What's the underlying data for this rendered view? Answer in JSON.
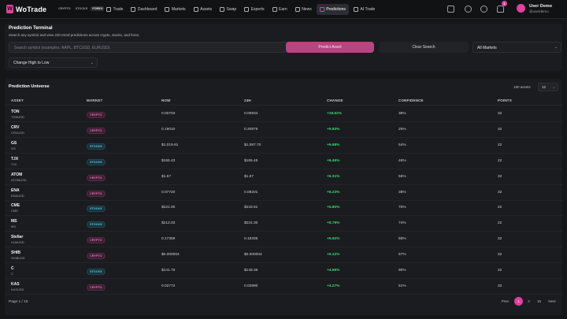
{
  "brand": {
    "name": "WoTrade",
    "mark": "W"
  },
  "market_switch": [
    {
      "label": "CRYPTO",
      "active": false
    },
    {
      "label": "STOCKS",
      "active": false
    },
    {
      "label": "FOREX",
      "active": true
    }
  ],
  "nav": [
    {
      "label": "Trade",
      "icon": "trade-icon",
      "active": false
    },
    {
      "label": "Dashboard",
      "icon": "dashboard-icon",
      "active": false
    },
    {
      "label": "Markets",
      "icon": "markets-icon",
      "active": false
    },
    {
      "label": "Assets",
      "icon": "assets-icon",
      "active": false
    },
    {
      "label": "Swap",
      "icon": "swap-icon",
      "active": false
    },
    {
      "label": "Experts",
      "icon": "experts-icon",
      "active": false
    },
    {
      "label": "Earn",
      "icon": "earn-icon",
      "active": false
    },
    {
      "label": "News",
      "icon": "news-icon",
      "active": false
    },
    {
      "label": "Predictions",
      "icon": "predictions-icon",
      "active": true
    },
    {
      "label": "AI Trade",
      "icon": "robot-icon",
      "active": false
    }
  ],
  "topbar": {
    "notification_count": "1",
    "user_name": "User Demo",
    "user_handle": "@userdemo"
  },
  "terminal": {
    "title": "Prediction Terminal",
    "subtitle": "Search any symbol and view 24h trend predictions across crypto, stocks, and forex.",
    "search_placeholder": "Search symbol (examples: AAPL, BTCUSD, EURUSD)",
    "predict_label": "Predict Asset",
    "clear_label": "Clear Search",
    "market_select": "All Markets",
    "sort_select": "Change High to Low"
  },
  "universe": {
    "title": "Prediction Universe",
    "count": "180",
    "count_label": "assets",
    "per_page": "12",
    "columns": [
      "ASSET",
      "MARKET",
      "NOW",
      "24H",
      "CHANGE",
      "CONFIDENCE",
      "POINTS"
    ],
    "rows": [
      {
        "symbol": "TON",
        "pair": "TONUSD",
        "market": "CRYPTO",
        "now": "0.00703",
        "h24": "0.00834",
        "change": "+18.62%",
        "confidence": "38%",
        "points": "32"
      },
      {
        "symbol": "CRV",
        "pair": "CRVUSD",
        "market": "CRYPTO",
        "now": "0.19010",
        "h24": "0.20879",
        "change": "+9.83%",
        "confidence": "25%",
        "points": "32"
      },
      {
        "symbol": "GS",
        "pair": "GS",
        "market": "STOCKS",
        "now": "$1,019.61",
        "h24": "$1,087.70",
        "change": "+6.68%",
        "confidence": "54%",
        "points": "22"
      },
      {
        "symbol": "TJX",
        "pair": "TJX",
        "market": "STOCKS",
        "now": "$155.43",
        "h24": "$165.45",
        "change": "+6.46%",
        "confidence": "46%",
        "points": "22"
      },
      {
        "symbol": "ATOM",
        "pair": "ATOMUSD",
        "market": "CRYPTO",
        "now": "$1.57",
        "h24": "$1.67",
        "change": "+6.31%",
        "confidence": "56%",
        "points": "32"
      },
      {
        "symbol": "ENA",
        "pair": "ENAUSD",
        "market": "CRYPTO",
        "now": "0.07720",
        "h24": "0.08201",
        "change": "+6.23%",
        "confidence": "38%",
        "points": "32"
      },
      {
        "symbol": "CME",
        "pair": "CME",
        "market": "STOCKS",
        "now": "$221.00",
        "h24": "$233.61",
        "change": "+5.80%",
        "confidence": "76%",
        "points": "22"
      },
      {
        "symbol": "MS",
        "pair": "MS",
        "market": "STOCKS",
        "now": "$212.03",
        "h24": "$224.30",
        "change": "+5.79%",
        "confidence": "74%",
        "points": "22"
      },
      {
        "symbol": "Stellar",
        "pair": "XLMUSD",
        "market": "CRYPTO",
        "now": "0.17359",
        "h24": "0.18335",
        "change": "+5.62%",
        "confidence": "58%",
        "points": "32"
      },
      {
        "symbol": "SHIB",
        "pair": "SHIBUSD",
        "market": "CRYPTO",
        "now": "$0.000004",
        "h24": "$0.000004",
        "change": "+5.12%",
        "confidence": "67%",
        "points": "32"
      },
      {
        "symbol": "C",
        "pair": "C",
        "market": "STOCKS",
        "now": "$141.76",
        "h24": "$148.36",
        "change": "+4.66%",
        "confidence": "95%",
        "points": "22"
      },
      {
        "symbol": "KAS",
        "pair": "KASUSD",
        "market": "CRYPTO",
        "now": "0.02772",
        "h24": "0.02890",
        "change": "+4.27%",
        "confidence": "51%",
        "points": "32"
      }
    ],
    "page_info": "Page 1 / 15",
    "pager": {
      "prev": "Prev",
      "pages": [
        "1",
        "2",
        "15"
      ],
      "next": "Next"
    }
  }
}
